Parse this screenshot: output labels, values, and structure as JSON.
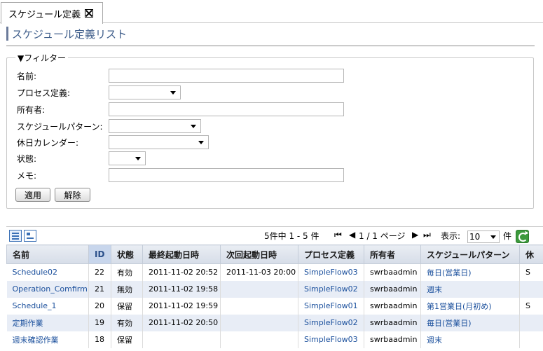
{
  "tab": {
    "label": "スケジュール定義"
  },
  "page": {
    "title": "スケジュール定義リスト"
  },
  "filter": {
    "legend": "▼フィルター",
    "fields": {
      "name": {
        "label": "名前:",
        "value": ""
      },
      "process": {
        "label": "プロセス定義:",
        "value": ""
      },
      "owner": {
        "label": "所有者:",
        "value": ""
      },
      "pattern": {
        "label": "スケジュールパターン:",
        "value": ""
      },
      "calendar": {
        "label": "休日カレンダー:",
        "value": ""
      },
      "status": {
        "label": "状態:",
        "value": ""
      },
      "memo": {
        "label": "メモ:",
        "value": ""
      }
    },
    "apply_label": "適用",
    "clear_label": "解除"
  },
  "pager": {
    "summary": "5件中 1 - 5 件",
    "page_info": "1 / 1 ページ",
    "display_label": "表示:",
    "page_size": "10",
    "unit": "件"
  },
  "table": {
    "headers": [
      "名前",
      "ID",
      "状態",
      "最終起動日時",
      "次回起動日時",
      "プロセス定義",
      "所有者",
      "スケジュールパターン",
      "休"
    ],
    "rows": [
      {
        "name": "Schedule02",
        "id": "22",
        "status": "有効",
        "last": "2011-11-02 20:52",
        "next": "2011-11-03 20:00",
        "process": "SimpleFlow03",
        "owner": "swrbaadmin",
        "pattern": "毎日(営業日)",
        "extra": "S"
      },
      {
        "name": "Operation_Comfirm",
        "id": "21",
        "status": "無効",
        "last": "2011-11-02 19:58",
        "next": "",
        "process": "SimpleFlow02",
        "owner": "swrbaadmin",
        "pattern": "週末",
        "extra": ""
      },
      {
        "name": "Schedule_1",
        "id": "20",
        "status": "保留",
        "last": "2011-11-02 19:59",
        "next": "",
        "process": "SimpleFlow01",
        "owner": "swrbaadmin",
        "pattern": "第1営業日(月初め)",
        "extra": "S"
      },
      {
        "name": "定期作業",
        "id": "19",
        "status": "有効",
        "last": "2011-11-02 20:50",
        "next": "",
        "process": "SimpleFlow02",
        "owner": "swrbaadmin",
        "pattern": "毎日(営業日)",
        "extra": ""
      },
      {
        "name": "週末確認作業",
        "id": "18",
        "status": "保留",
        "last": "",
        "next": "",
        "process": "SimpleFlow03",
        "owner": "swrbaadmin",
        "pattern": "週末",
        "extra": ""
      }
    ]
  }
}
